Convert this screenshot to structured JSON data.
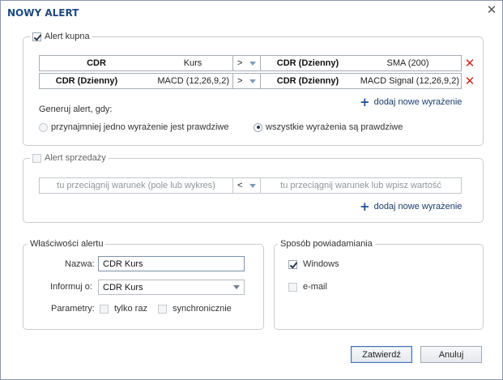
{
  "dialog": {
    "title": "NOWY ALERT"
  },
  "buy": {
    "label": "Alert kupna",
    "checked": true,
    "rows": [
      {
        "left_name": "CDR",
        "left_value": "Kurs",
        "operator": ">",
        "right_name": "CDR (Dzienny)",
        "right_value": "SMA (200)"
      },
      {
        "left_name": "CDR (Dzienny)",
        "left_value": "MACD (12,26,9,2)",
        "operator": ">",
        "right_name": "CDR (Dzienny)",
        "right_value": "MACD Signal (12,26,9,2)"
      }
    ],
    "add_label": "dodaj nowe wyrażenie",
    "generate_label": "Generuj alert, gdy:",
    "radio_any": "przynajmniej jedno wyrażenie jest prawdziwe",
    "radio_all": "wszystkie wyrażenia są prawdziwe",
    "selected_radio": "all"
  },
  "sell": {
    "label": "Alert sprzedaży",
    "checked": false,
    "left_placeholder": "tu przeciągnij warunek (pole lub wykres)",
    "operator": "<",
    "right_placeholder": "tu przeciągnij warunek lub wpisz wartość",
    "add_label": "dodaj nowe wyrażenie"
  },
  "properties": {
    "label": "Właściwości alertu",
    "name_label": "Nazwa:",
    "name_value": "CDR Kurs",
    "inform_label": "Informuj o:",
    "inform_value": "CDR Kurs",
    "params_label": "Parametry:",
    "once_label": "tylko raz",
    "sync_label": "synchronicznie"
  },
  "notify": {
    "label": "Sposób powiadamiania",
    "windows_label": "Windows",
    "windows_checked": true,
    "email_label": "e-mail",
    "email_checked": false
  },
  "buttons": {
    "confirm": "Zatwierdź",
    "cancel": "Anuluj"
  },
  "colors": {
    "title": "#1f4a80",
    "delete": "#d9231a",
    "add": "#1e4f96"
  },
  "icons": {
    "close": "close-icon",
    "delete": "delete-x-icon",
    "add": "plus-icon"
  }
}
